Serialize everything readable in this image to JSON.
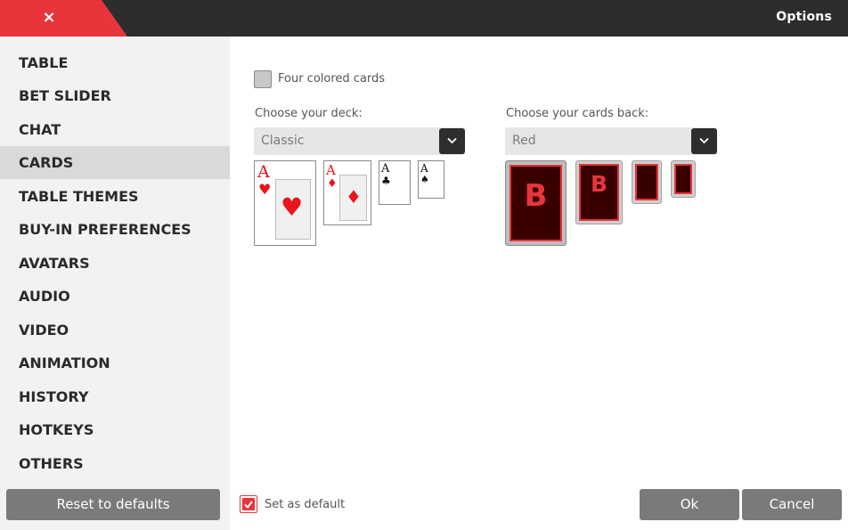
{
  "window": {
    "title": "Options",
    "close_glyph": "×"
  },
  "sidebar": {
    "items": [
      {
        "label": "TABLE"
      },
      {
        "label": "BET SLIDER"
      },
      {
        "label": "CHAT"
      },
      {
        "label": "CARDS",
        "active": true
      },
      {
        "label": "TABLE THEMES"
      },
      {
        "label": "BUY-IN PREFERENCES"
      },
      {
        "label": "AVATARS"
      },
      {
        "label": "AUDIO"
      },
      {
        "label": "VIDEO"
      },
      {
        "label": "ANIMATION"
      },
      {
        "label": "HISTORY"
      },
      {
        "label": "HOTKEYS"
      },
      {
        "label": "OTHERS"
      }
    ],
    "reset_label": "Reset to defaults"
  },
  "cards": {
    "four_colored_label": "Four colored cards",
    "four_colored_checked": false,
    "deck": {
      "label": "Choose your deck:",
      "selected": "Classic",
      "previews": [
        {
          "rank": "A",
          "suit": "♥",
          "color": "#e8151b"
        },
        {
          "rank": "A",
          "suit": "♦",
          "color": "#e8151b"
        },
        {
          "rank": "A",
          "suit": "♣",
          "color": "#111111"
        },
        {
          "rank": "A",
          "suit": "♠",
          "color": "#111111"
        }
      ]
    },
    "back": {
      "label": "Choose your cards back:",
      "selected": "Red",
      "logo_letter": "B",
      "colors": {
        "face": "#3a0000",
        "accent": "#e8353b"
      }
    }
  },
  "footer": {
    "set_default_label": "Set as default",
    "set_default_checked": true,
    "ok_label": "Ok",
    "cancel_label": "Cancel"
  }
}
